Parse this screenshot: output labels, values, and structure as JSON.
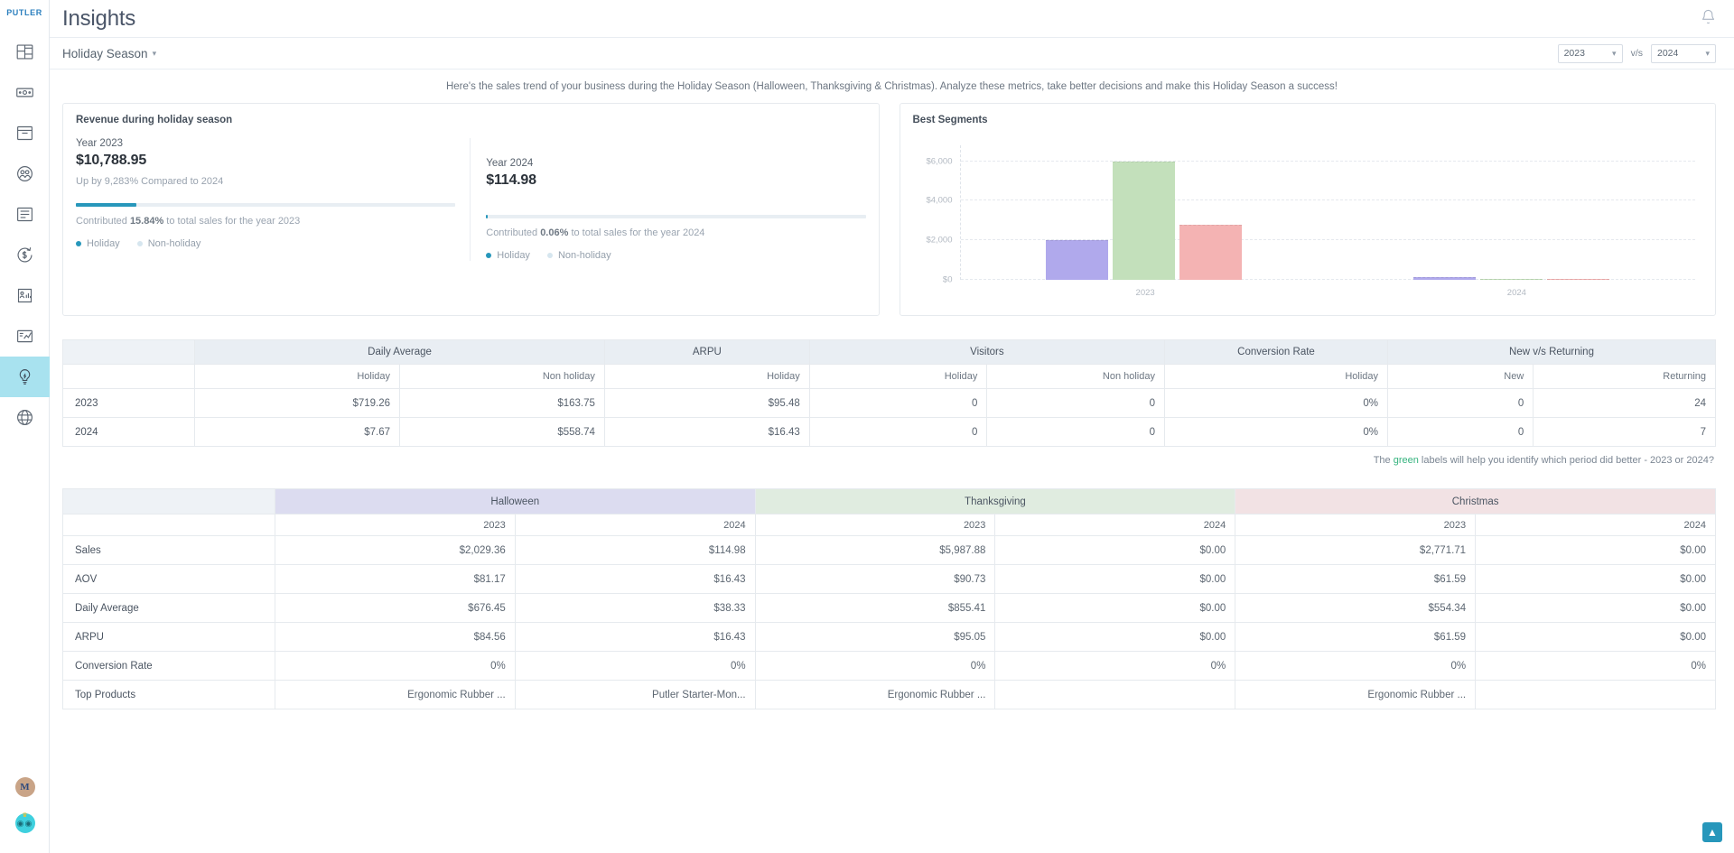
{
  "brand": "PUTLER",
  "sidebar": {
    "items": [
      {
        "name": "dashboard",
        "icon": "dashboard-icon",
        "active": false
      },
      {
        "name": "sales",
        "icon": "banknote-icon",
        "active": false
      },
      {
        "name": "products",
        "icon": "box-icon",
        "active": false
      },
      {
        "name": "customers",
        "icon": "people-icon",
        "active": false
      },
      {
        "name": "transactions",
        "icon": "list-icon",
        "active": false
      },
      {
        "name": "refunds",
        "icon": "dollar-refresh-icon",
        "active": false
      },
      {
        "name": "audience",
        "icon": "audience-chart-icon",
        "active": false
      },
      {
        "name": "reports",
        "icon": "report-chart-icon",
        "active": false
      },
      {
        "name": "insights",
        "icon": "lightbulb-icon",
        "active": true
      },
      {
        "name": "web-analytics",
        "icon": "globe-icon",
        "active": false
      }
    ],
    "avatar_initial": "M"
  },
  "header": {
    "title": "Insights",
    "notification_icon": "bell-icon"
  },
  "subbar": {
    "season_label": "Holiday Season",
    "year_left": "2023",
    "vs": "v/s",
    "year_right": "2024"
  },
  "intro_note": "Here's the sales trend of your business during the Holiday Season (Halloween, Thanksgiving & Christmas). Analyze these metrics, take better decisions and make this Holiday Season a success!",
  "revenue_card": {
    "title": "Revenue during holiday season",
    "left": {
      "year_label": "Year 2023",
      "amount": "$10,788.95",
      "delta": "Up by 9,283% Compared to 2024",
      "bar_percent": 15.84,
      "contributed_prefix": "Contributed ",
      "contributed_value": "15.84%",
      "contributed_suffix": " to total sales for the year 2023"
    },
    "right": {
      "year_label": "Year 2024",
      "amount": "$114.98",
      "bar_percent": 0.06,
      "contributed_prefix": "Contributed ",
      "contributed_value": "0.06%",
      "contributed_suffix": " to total sales for the year 2024"
    },
    "legend": {
      "holiday": "Holiday",
      "non_holiday": "Non-holiday"
    },
    "colors": {
      "holiday": "#2797bb",
      "non_holiday": "#d6e6ef"
    }
  },
  "segments_card": {
    "title": "Best Segments"
  },
  "chart_data": {
    "type": "bar",
    "title": "Best Segments",
    "xlabel": "",
    "ylabel": "",
    "ylim": [
      0,
      6800
    ],
    "yticks": [
      0,
      2000,
      4000,
      6000
    ],
    "ytick_labels": [
      "$0",
      "$2,000",
      "$4,000",
      "$6,000"
    ],
    "categories": [
      "2023",
      "2024"
    ],
    "grid": true,
    "legend_position": "none",
    "series": [
      {
        "name": "Halloween",
        "color": "#b0a9ec",
        "values": [
          2029.36,
          114.98
        ]
      },
      {
        "name": "Thanksgiving",
        "color": "#c3e0bb",
        "values": [
          5987.88,
          0.0
        ]
      },
      {
        "name": "Christmas",
        "color": "#f4b3b3",
        "values": [
          2771.71,
          0.0
        ]
      }
    ]
  },
  "table1": {
    "groups": [
      "",
      "Daily Average",
      "ARPU",
      "Visitors",
      "Conversion Rate",
      "New v/s Returning"
    ],
    "subheaders": [
      "",
      "Holiday",
      "Non holiday",
      "Holiday",
      "Holiday",
      "Non holiday",
      "Holiday",
      "New",
      "Returning"
    ],
    "rows": [
      {
        "label": "2023",
        "cells": [
          {
            "value": "$719.26",
            "highlight": true
          },
          {
            "value": "$163.75",
            "highlight": false
          },
          {
            "value": "$95.48",
            "highlight": true
          },
          {
            "value": "0",
            "highlight": false
          },
          {
            "value": "0",
            "highlight": false
          },
          {
            "value": "0%",
            "highlight": false
          },
          {
            "value": "0",
            "highlight": false
          },
          {
            "value": "24",
            "highlight": true
          }
        ]
      },
      {
        "label": "2024",
        "cells": [
          {
            "value": "$7.67",
            "highlight": false
          },
          {
            "value": "$558.74",
            "highlight": true
          },
          {
            "value": "$16.43",
            "highlight": false
          },
          {
            "value": "0",
            "highlight": false
          },
          {
            "value": "0",
            "highlight": false
          },
          {
            "value": "0%",
            "highlight": false
          },
          {
            "value": "0",
            "highlight": false
          },
          {
            "value": "7",
            "highlight": true
          }
        ]
      }
    ],
    "footnote_prefix": "The ",
    "footnote_green": "green",
    "footnote_suffix": " labels will help you identify which period did better - 2023 or 2024?"
  },
  "table2": {
    "groups": [
      "",
      "Halloween",
      "Thanksgiving",
      "Christmas"
    ],
    "years": [
      "2023",
      "2024",
      "2023",
      "2024",
      "2023",
      "2024"
    ],
    "rows": [
      {
        "label": "Sales",
        "cells": [
          "$2,029.36",
          "$114.98",
          "$5,987.88",
          "$0.00",
          "$2,771.71",
          "$0.00"
        ],
        "blue": [
          true,
          false,
          true,
          false,
          true,
          false
        ]
      },
      {
        "label": "AOV",
        "cells": [
          "$81.17",
          "$16.43",
          "$90.73",
          "$0.00",
          "$61.59",
          "$0.00"
        ],
        "blue": [
          true,
          false,
          true,
          false,
          true,
          false
        ]
      },
      {
        "label": "Daily Average",
        "cells": [
          "$676.45",
          "$38.33",
          "$855.41",
          "$0.00",
          "$554.34",
          "$0.00"
        ],
        "blue": [
          true,
          false,
          true,
          false,
          true,
          false
        ]
      },
      {
        "label": "ARPU",
        "cells": [
          "$84.56",
          "$16.43",
          "$95.05",
          "$0.00",
          "$61.59",
          "$0.00"
        ],
        "blue": [
          true,
          false,
          true,
          false,
          true,
          false
        ]
      },
      {
        "label": "Conversion Rate",
        "cells": [
          "0%",
          "0%",
          "0%",
          "0%",
          "0%",
          "0%"
        ],
        "blue": [
          true,
          false,
          true,
          false,
          true,
          false
        ]
      },
      {
        "label": "Top Products",
        "cells": [
          "Ergonomic Rubber ...",
          "Putler Starter-Mon...",
          "Ergonomic Rubber ...",
          "",
          "Ergonomic Rubber ...",
          ""
        ],
        "blue": [
          true,
          false,
          true,
          false,
          true,
          false
        ]
      }
    ]
  },
  "scroll_top_icon": "arrow-up-icon"
}
